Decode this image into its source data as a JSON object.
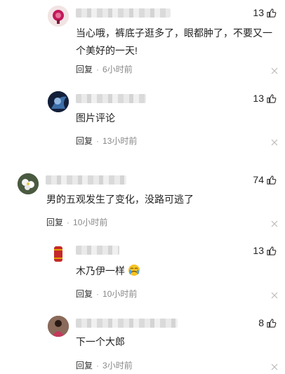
{
  "comments": [
    {
      "likes": "13",
      "text": "当心哦，裤底子逛多了，眼都肿了，不要又一个美好的一天!",
      "reply": "回复",
      "time": "6小时前",
      "avatar_icon": "pink-flower-avatar"
    },
    {
      "likes": "13",
      "text": "图片评论",
      "reply": "回复",
      "time": "13小时前",
      "avatar_icon": "dark-blue-avatar"
    },
    {
      "likes": "74",
      "text": "男的五观发生了变化，没路可逃了",
      "reply": "回复",
      "time": "10小时前",
      "avatar_icon": "white-flower-avatar"
    },
    {
      "likes": "13",
      "text": "木乃伊一样",
      "reply": "回复",
      "time": "10小时前",
      "avatar_icon": "red-lantern-avatar",
      "emoji": "crying-face-emoji"
    },
    {
      "likes": "8",
      "text": "下一个大郎",
      "reply": "回复",
      "time": "3小时前",
      "avatar_icon": "person-photo-avatar"
    }
  ],
  "dot": "·",
  "colors": {
    "text": "#222222",
    "meta": "#888888",
    "like_icon": "#333333"
  }
}
